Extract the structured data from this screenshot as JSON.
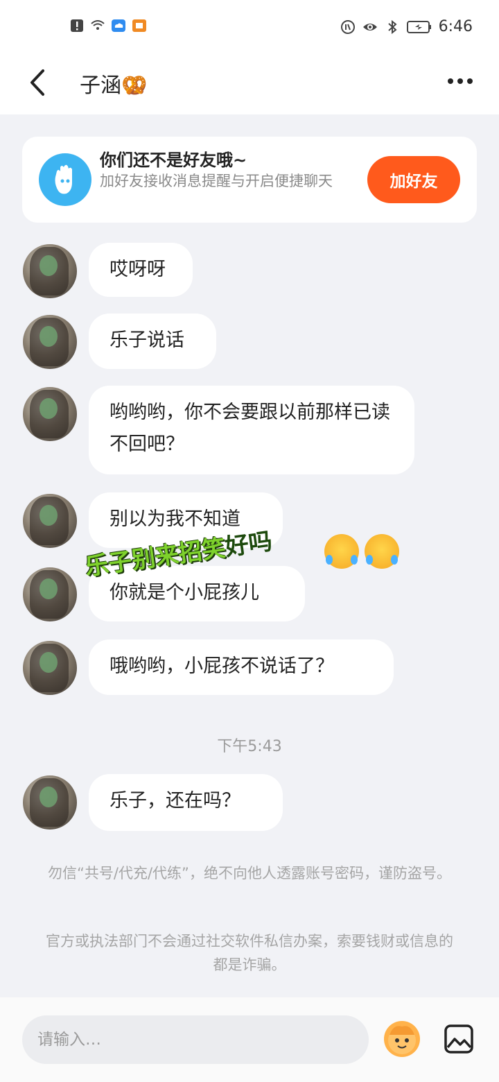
{
  "status_bar": {
    "time": "6:46",
    "icons": [
      "alert-icon",
      "wifi-icon",
      "cloud-icon",
      "app-notification-icon",
      "nfc-icon",
      "eye-icon",
      "bluetooth-icon",
      "battery-icon"
    ]
  },
  "header": {
    "title": "子涵🥨"
  },
  "friend_card": {
    "title": "你们还不是好友哦~",
    "subtitle": "加好友接收消息提醒与开启便捷聊天",
    "button": "加好友"
  },
  "messages": [
    {
      "text": "哎呀呀"
    },
    {
      "text": "乐子说话"
    },
    {
      "text": "哟哟哟，你不会要跟以前那样已读不回吧？"
    },
    {
      "text": "别以为我不知道"
    },
    {
      "text": "你就是个小屁孩儿"
    },
    {
      "text": "哦哟哟，小屁孩不说话了？"
    },
    {
      "text": "乐子，还在吗？"
    }
  ],
  "sticker_text": {
    "part1": "乐子别来招笑",
    "part2": "好吗"
  },
  "time_divider": "下午5:43",
  "notices": [
    "勿信“共号/代充/代练”，绝不向他人透露账号密码，谨防盗号。",
    "官方或执法部门不会通过社交软件私信办案，索要钱财或信息的都是诈骗。"
  ],
  "input": {
    "placeholder": "请输入…"
  }
}
